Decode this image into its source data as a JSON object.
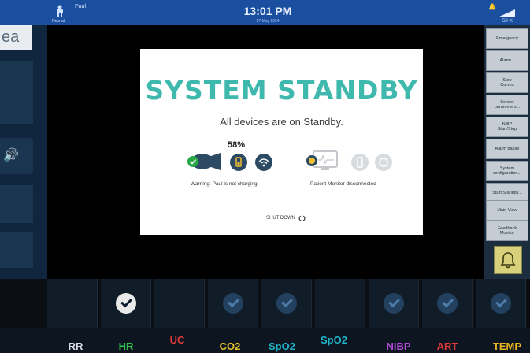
{
  "status_bar": {
    "patient_name": "Paul",
    "patient_sub": "Neonat",
    "time": "13:01 PM",
    "date": "17-May 2024",
    "battery": "58 %"
  },
  "left_panel": {
    "top_text": "ea"
  },
  "right_menu": [
    {
      "label": "Emergency"
    },
    {
      "label": "Alarm..."
    },
    {
      "label": "Stop\nCurves"
    },
    {
      "label": "Sensor\nparameters..."
    },
    {
      "label": "NIBP\nStart/Stop"
    },
    {
      "label": "Alarm pause"
    },
    {
      "label": "System\nconfiguration..."
    },
    {
      "label": "Start/Standby..."
    },
    {
      "label": "Main View"
    },
    {
      "label": "Feedback\nMonitor"
    }
  ],
  "modal": {
    "title": "SYSTEM STANDBY",
    "subtitle": "All devices are on Standby.",
    "battery_percent": "58%",
    "warning": "Warning: Paul is not charging!",
    "monitor_status": "Patient Monitor disconnected",
    "shutdown": "SHUT DOWN"
  },
  "tiles": [
    {
      "state": "none"
    },
    {
      "state": "checked-white"
    },
    {
      "state": "none"
    },
    {
      "state": "checked-blue"
    },
    {
      "state": "checked-blue"
    },
    {
      "state": "none"
    },
    {
      "state": "checked-blue"
    },
    {
      "state": "checked-blue"
    },
    {
      "state": "checked-blue"
    }
  ],
  "vitals": [
    {
      "label": "RR",
      "color": "#d8dce2"
    },
    {
      "label": "HR",
      "color": "#2fbf4a"
    },
    {
      "label": "UC",
      "color": "#e03a3a"
    },
    {
      "label": "CO2",
      "color": "#e8c22a"
    },
    {
      "label": "SpO2",
      "color": "#1fb5c9"
    },
    {
      "label": "SpO2",
      "color": "#1fb5c9"
    },
    {
      "label": "NIBP",
      "color": "#b04bd6"
    },
    {
      "label": "ART",
      "color": "#e03a3a"
    },
    {
      "label": "TEMP",
      "color": "#e8b422"
    }
  ]
}
